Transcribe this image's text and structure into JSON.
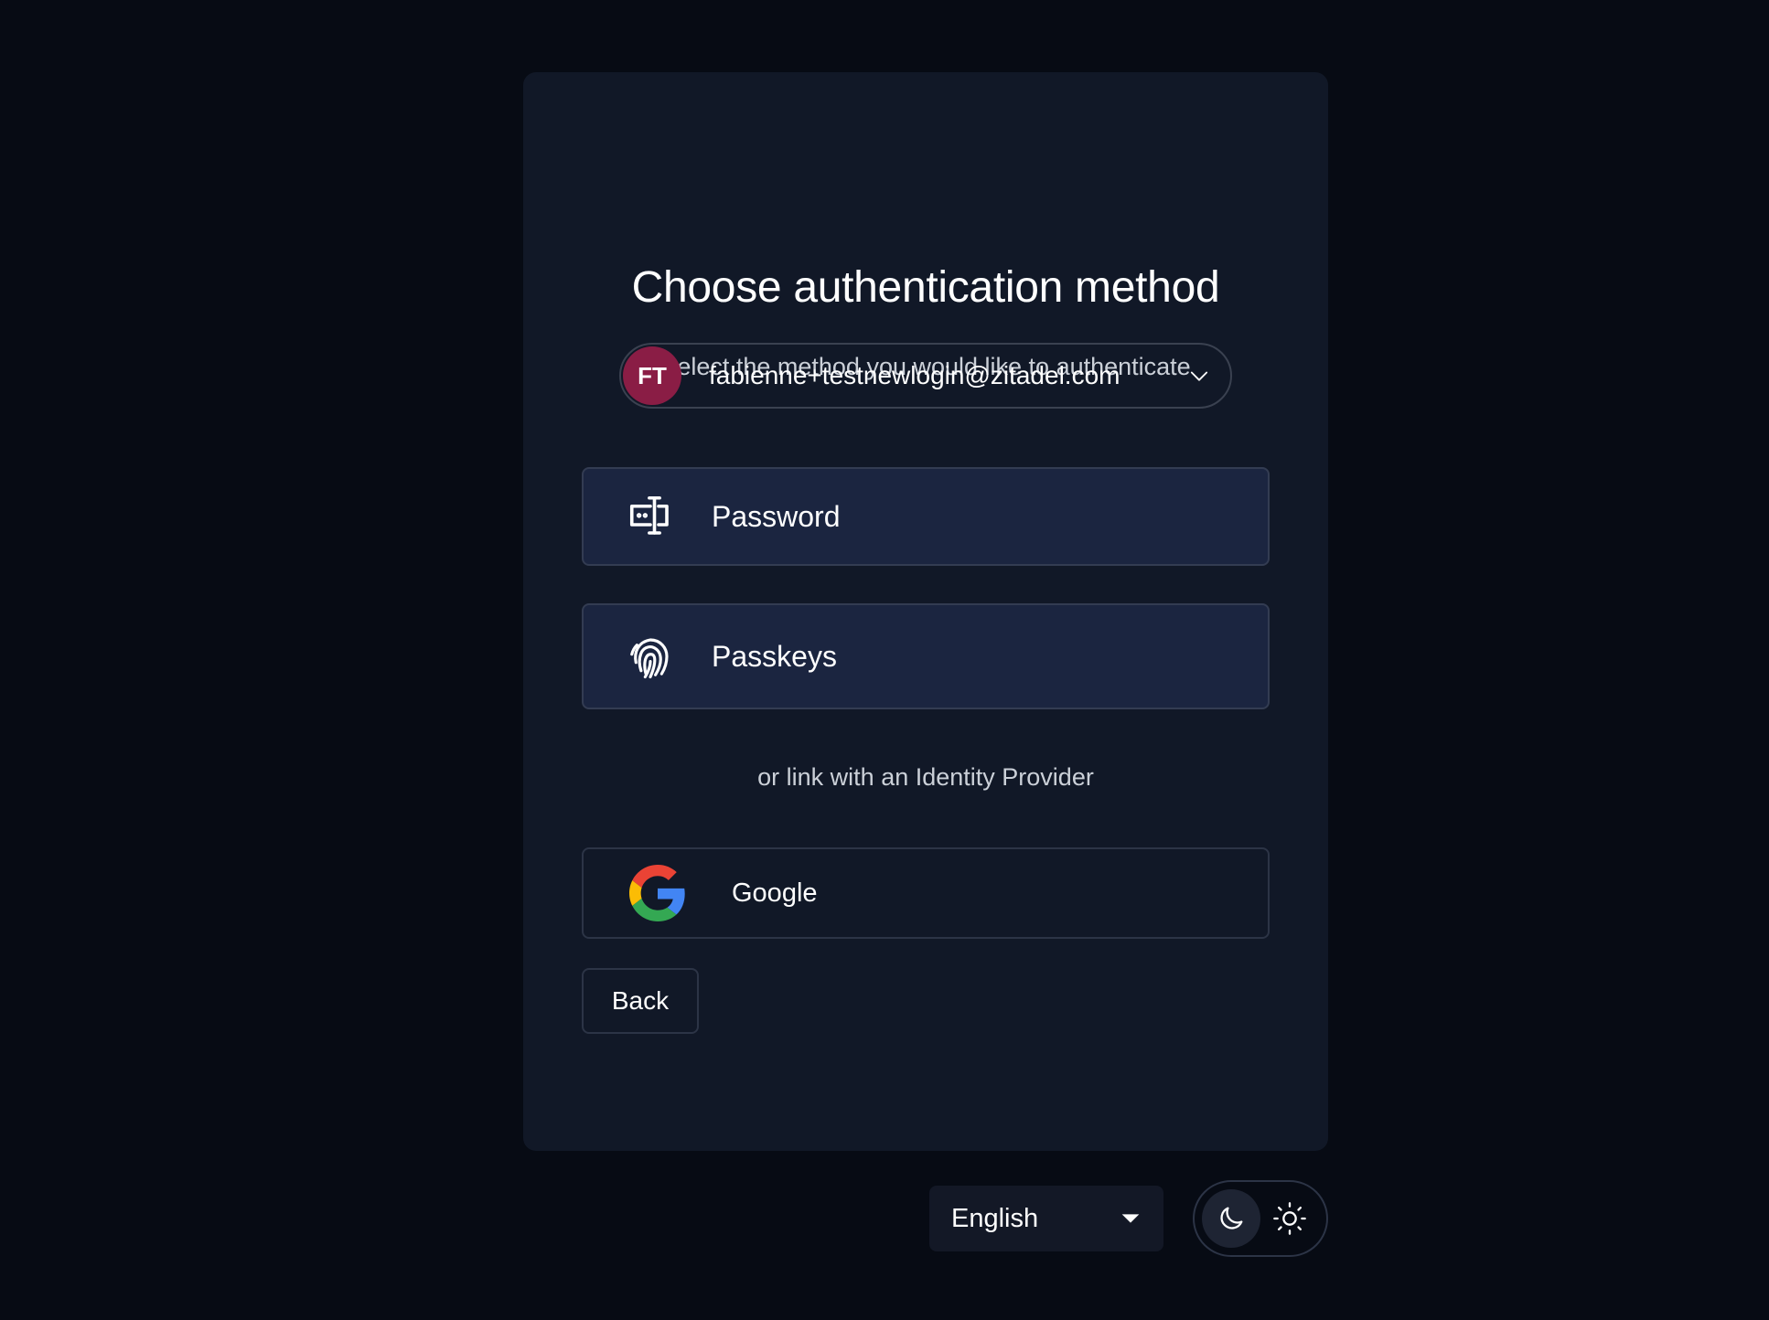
{
  "heading": {
    "title": "Choose authentication method",
    "subtitle": "Select the method you would like to authenticate"
  },
  "account": {
    "initials": "FT",
    "email": "fabienne+testnewlogin@zitadel.com",
    "avatar_color": "#8a1d45"
  },
  "methods": [
    {
      "label": "Password",
      "icon": "password-icon"
    },
    {
      "label": "Passkeys",
      "icon": "fingerprint-icon"
    }
  ],
  "idp": {
    "divider_text": "or link with an Identity Provider",
    "providers": [
      {
        "label": "Google",
        "icon": "google-icon"
      }
    ]
  },
  "actions": {
    "back_label": "Back"
  },
  "footer": {
    "language": "English",
    "theme_selected": "dark"
  },
  "colors": {
    "background": "#070b14",
    "card": "#111827",
    "method_bg": "#1b2540"
  }
}
